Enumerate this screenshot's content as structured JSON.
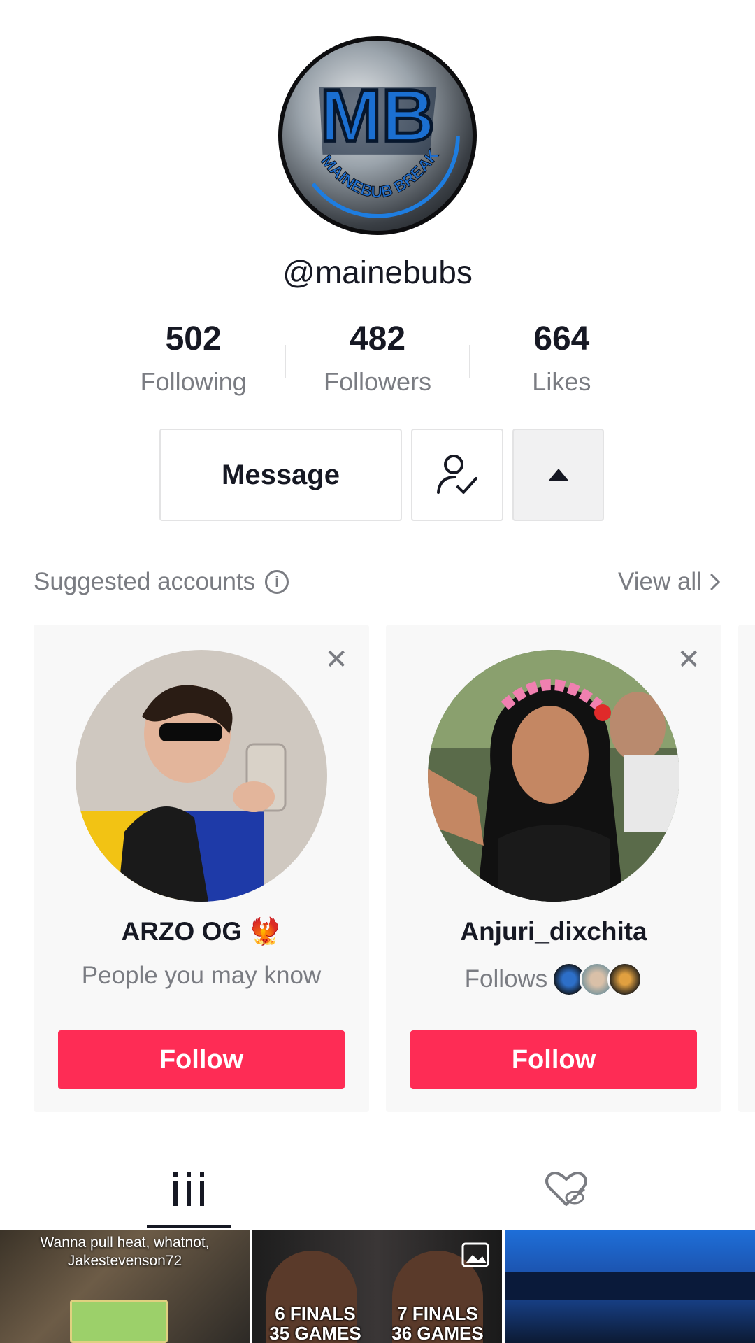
{
  "profile": {
    "handle": "@mainebubs",
    "avatar_text": "MB",
    "avatar_ring_text": "MAINEBUB BREAKS"
  },
  "stats": [
    {
      "value": "502",
      "label": "Following"
    },
    {
      "value": "482",
      "label": "Followers"
    },
    {
      "value": "664",
      "label": "Likes"
    }
  ],
  "actions": {
    "message_label": "Message",
    "friend_icon": "user-check-icon",
    "more_icon": "caret-up-icon"
  },
  "suggested": {
    "title": "Suggested accounts",
    "info_icon": "i",
    "view_all": "View all",
    "cards": [
      {
        "name": "ARZO OG 🐦‍🔥",
        "subtitle": "People you may know",
        "follow_label": "Follow"
      },
      {
        "name": "Anjuri_dixchita",
        "subtitle": "Follows",
        "follow_label": "Follow"
      }
    ]
  },
  "tabs": {
    "videos_icon": "grid-icon",
    "liked_icon": "hidden-heart-icon"
  },
  "thumbnails": [
    {
      "caption": "Wanna pull heat, whatnot, Jakestevenson72"
    },
    {
      "left_text": "6 FINALS\n35 GAMES",
      "right_text": "7 FINALS\n36 GAMES"
    },
    {
      "caption": ""
    }
  ],
  "colors": {
    "accent": "#fe2c55",
    "muted_text": "#7a7c82",
    "border": "#e3e3e4"
  }
}
